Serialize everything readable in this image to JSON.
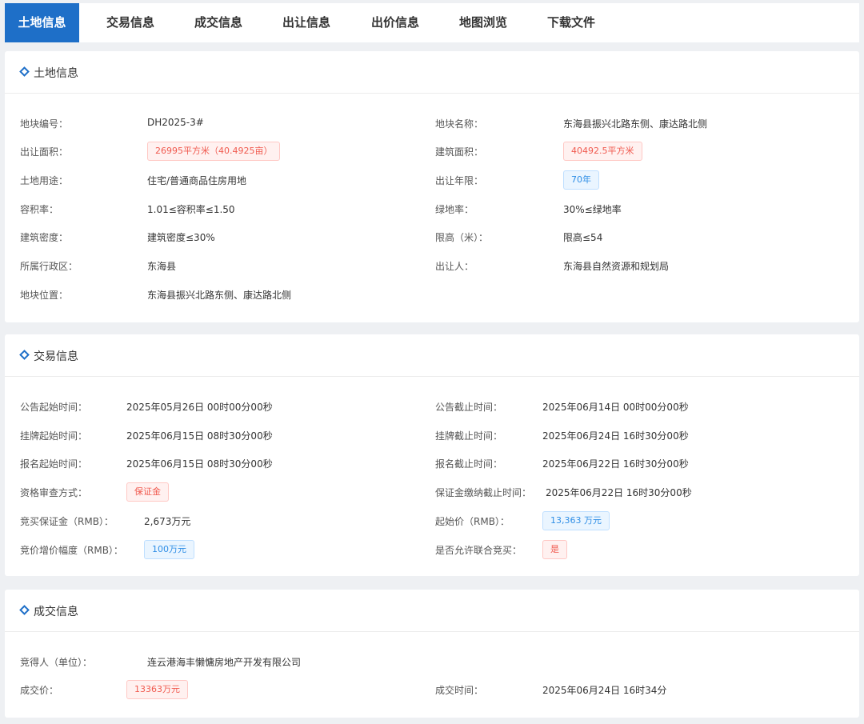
{
  "tabs": [
    {
      "label": "土地信息"
    },
    {
      "label": "交易信息"
    },
    {
      "label": "成交信息"
    },
    {
      "label": "出让信息"
    },
    {
      "label": "出价信息"
    },
    {
      "label": "地图浏览"
    },
    {
      "label": "下载文件"
    }
  ],
  "colors": {
    "accent": "#1e6fc8",
    "tag_red": "#f05a4f",
    "tag_blue": "#2f8ee6"
  },
  "land": {
    "title": "土地信息",
    "plot_no_label": "地块编号：",
    "plot_no": "DH2025-3#",
    "plot_name_label": "地块名称：",
    "plot_name": "东海县振兴北路东侧、康达路北侧",
    "area_label": "出让面积：",
    "area": "26995平方米（40.4925亩）",
    "build_area_label": "建筑面积：",
    "build_area": "40492.5平方米",
    "use_label": "土地用途：",
    "use": "住宅/普通商品住房用地",
    "term_label": "出让年限：",
    "term": "70年",
    "far_label": "容积率：",
    "far": "1.01≤容积率≤1.50",
    "green_label": "绿地率：",
    "green": "30%≤绿地率",
    "density_label": "建筑密度：",
    "density": "建筑密度≤30%",
    "height_label": "限高（米）：",
    "height": "限高≤54",
    "district_label": "所属行政区：",
    "district": "东海县",
    "seller_label": "出让人：",
    "seller": "东海县自然资源和规划局",
    "location_label": "地块位置：",
    "location": "东海县振兴北路东侧、康达路北侧"
  },
  "trade": {
    "title": "交易信息",
    "notice_start_label": "公告起始时间：",
    "notice_start": "2025年05月26日 00时00分00秒",
    "notice_end_label": "公告截止时间：",
    "notice_end": "2025年06月14日 00时00分00秒",
    "listing_start_label": "挂牌起始时间：",
    "listing_start": "2025年06月15日 08时30分00秒",
    "listing_end_label": "挂牌截止时间：",
    "listing_end": "2025年06月24日 16时30分00秒",
    "reg_start_label": "报名起始时间：",
    "reg_start": "2025年06月15日 08时30分00秒",
    "reg_end_label": "报名截止时间：",
    "reg_end": "2025年06月22日 16时30分00秒",
    "review_label": "资格审查方式：",
    "review": "保证金",
    "deposit_deadline_label": "保证金缴纳截止时间：",
    "deposit_deadline": "2025年06月22日 16时30分00秒",
    "deposit_label": "竞买保证金（RMB）：",
    "deposit": "2,673万元",
    "start_price_label": "起始价（RMB）：",
    "start_price": "13,363 万元",
    "increment_label": "竞价增价幅度（RMB）：",
    "increment": "100万元",
    "joint_label": "是否允许联合竞买：",
    "joint": "是"
  },
  "deal": {
    "title": "成交信息",
    "winner_label": "竞得人（单位）：",
    "winner": "连云港海丰懒慵房地产开发有限公司",
    "price_label": "成交价：",
    "price": "13363万元",
    "time_label": "成交时间：",
    "time": "2025年06月24日 16时34分"
  }
}
